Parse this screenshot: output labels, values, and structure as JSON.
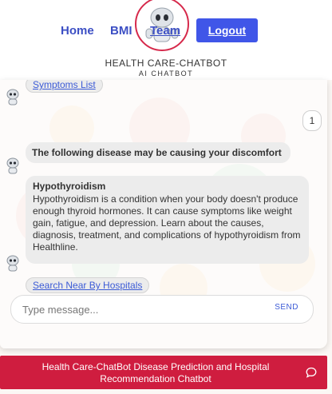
{
  "nav": {
    "home_label": "Home",
    "bmi_label": "BMI",
    "team_label": "Team",
    "logout_label": "Logout"
  },
  "brand": {
    "title": "HEALTH CARE-CHATBOT",
    "subtitle": "AI CHATBOT"
  },
  "chat": {
    "messages": [
      {
        "type": "bot-link",
        "text": "Symptoms List"
      },
      {
        "type": "user",
        "text": "1"
      },
      {
        "type": "bot",
        "text": "The following disease may be causing your discomfort"
      },
      {
        "type": "bot-card",
        "title": "Hypothyroidism",
        "text": "Hypothyroidism is a condition when your body doesn't produce enough thyroid hormones. It can cause symptoms like weight gain, fatigue, and depression. Learn about the causes, diagnosis, treatment, and complications of hypothyroidism from Healthline."
      },
      {
        "type": "bot-link",
        "text": "Search Near By Hospitals"
      }
    ]
  },
  "input": {
    "placeholder": "Type message...",
    "send_label": "SEND"
  },
  "footer": {
    "text": "Health Care-ChatBot Disease Prediction and Hospital Recommendation Chatbot"
  },
  "colors": {
    "accent": "#4056e8",
    "brand_red": "#cf1d3f",
    "link": "#3c5bd6"
  },
  "icons": [
    "robot-avatar-icon",
    "chat-bubble-icon"
  ]
}
